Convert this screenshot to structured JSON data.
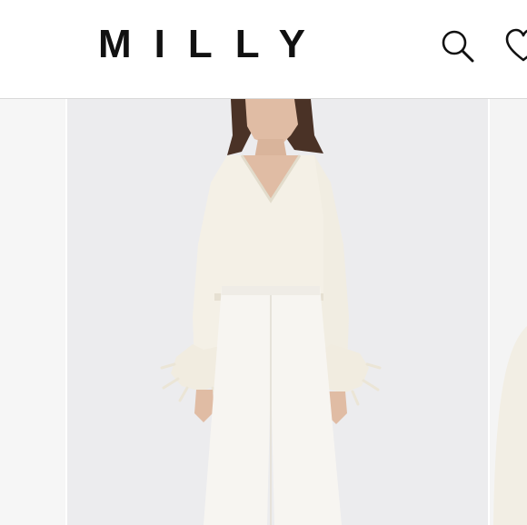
{
  "header": {
    "brand": "MILLY",
    "search_icon": "search-icon",
    "wishlist_icon": "heart-icon"
  },
  "gallery": {
    "product_image": "model-wearing-ivory-v-neck-sweater-with-feather-cuffs-and-white-trousers",
    "colors": {
      "background": "#ececee",
      "sweater": "#f4f0e6",
      "trousers": "#f7f5f1",
      "hair": "#4a3226",
      "skin": "#e0bca4"
    }
  }
}
